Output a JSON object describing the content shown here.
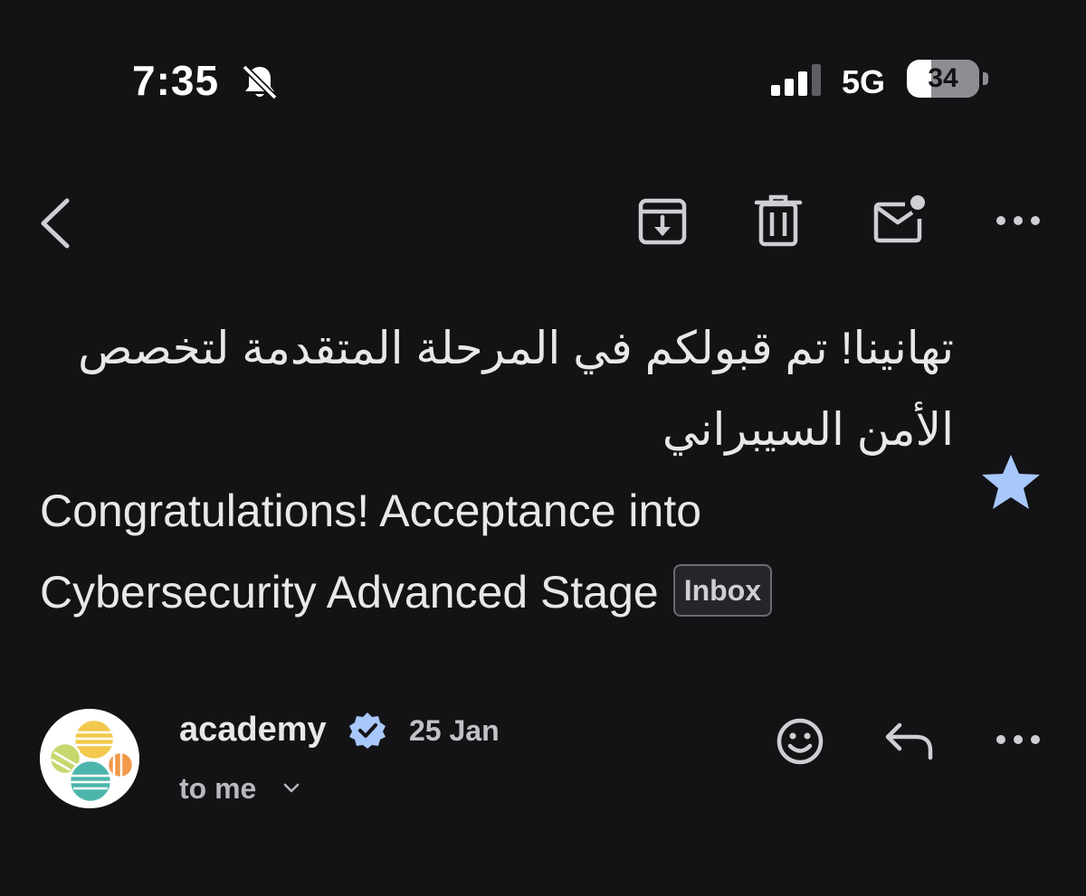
{
  "status_bar": {
    "time": "7:35",
    "network": "5G",
    "battery_percent": "34",
    "battery_level": 0.34,
    "signal_bars": 3
  },
  "toolbar": {
    "back_icon": "chevron-left-icon",
    "archive_icon": "archive-icon",
    "delete_icon": "trash-icon",
    "mark_unread_icon": "mail-unread-icon",
    "more_icon": "more-horizontal-icon"
  },
  "email": {
    "subject_arabic": "تهانينا! تم قبولكم في المرحلة المتقدمة لتخصص الأمن السيبراني",
    "subject_separator": " | ",
    "subject_english": "Congratulations! Acceptance into Cybersecurity Advanced Stage",
    "label": "Inbox",
    "starred": true,
    "sender": "academy",
    "verified": true,
    "date": "25 Jan",
    "recipient": "to me"
  },
  "colors": {
    "background": "#131316",
    "text": "#e8e8ea",
    "star": "#a8c7fa",
    "verified_badge": "#a8c7fa",
    "badge_border": "#6b6b70"
  }
}
